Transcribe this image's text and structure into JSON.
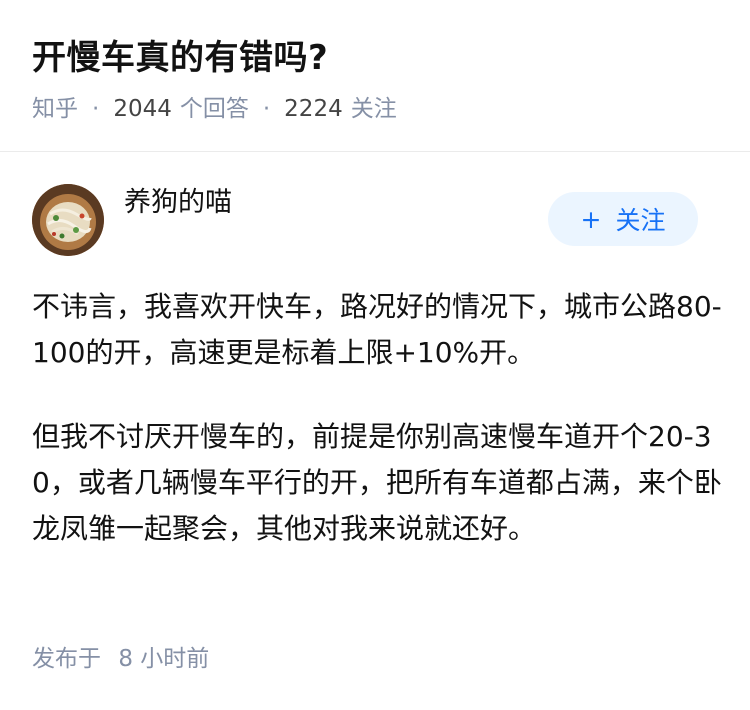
{
  "question": {
    "title": "开慢车真的有错吗?",
    "source": "知乎",
    "separator": "·",
    "answer_count": "2044",
    "answer_count_label": "个回答",
    "follower_count": "2224",
    "follower_count_label": "关注"
  },
  "author": {
    "name": "养狗的喵",
    "follow_plus": "+",
    "follow_label": "关注",
    "avatar_icon": "noodle-dish-avatar"
  },
  "answer": {
    "paragraphs": [
      "不讳言，我喜欢开快车，路况好的情况下，城市公路80-100的开，高速更是标着上限+10%开。",
      "但我不讨厌开慢车的，前提是你别高速慢车道开个20-30，或者几辆慢车平行的开，把所有车道都占满，来个卧龙凤雏一起聚会，其他对我来说就还好。"
    ]
  },
  "footer": {
    "published_label": "发布于",
    "published_num": "8",
    "published_unit": "小时前"
  },
  "colors": {
    "accent": "#1772f6",
    "follow_bg": "#ebf5ff",
    "meta_gray": "#8590a6"
  }
}
